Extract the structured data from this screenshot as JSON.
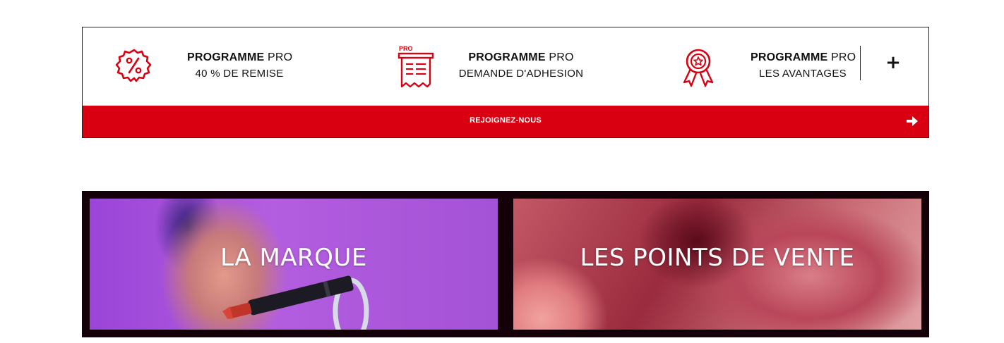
{
  "pro_program": {
    "items": [
      {
        "title_bold": "PROGRAMME",
        "title_light": "PRO",
        "subtitle": "40 % DE REMISE",
        "icon": "percent-badge-icon"
      },
      {
        "title_bold": "PROGRAMME",
        "title_light": "PRO",
        "subtitle": "DEMANDE D'ADHESION",
        "icon": "pro-application-form-icon",
        "icon_label": "PRO"
      },
      {
        "title_bold": "PROGRAMME",
        "title_light": "PRO",
        "subtitle": "LES AVANTAGES",
        "icon": "award-ribbon-icon"
      }
    ],
    "expand_label": "+",
    "join_label": "REJOIGNEZ-NOUS",
    "join_icon": "arrow-right-icon"
  },
  "tiles": [
    {
      "title": "LA MARQUE"
    },
    {
      "title": "LES POINTS DE VENTE"
    }
  ],
  "colors": {
    "accent_red": "#d90011",
    "tiles_frame": "#140008",
    "text_dark": "#111111"
  }
}
